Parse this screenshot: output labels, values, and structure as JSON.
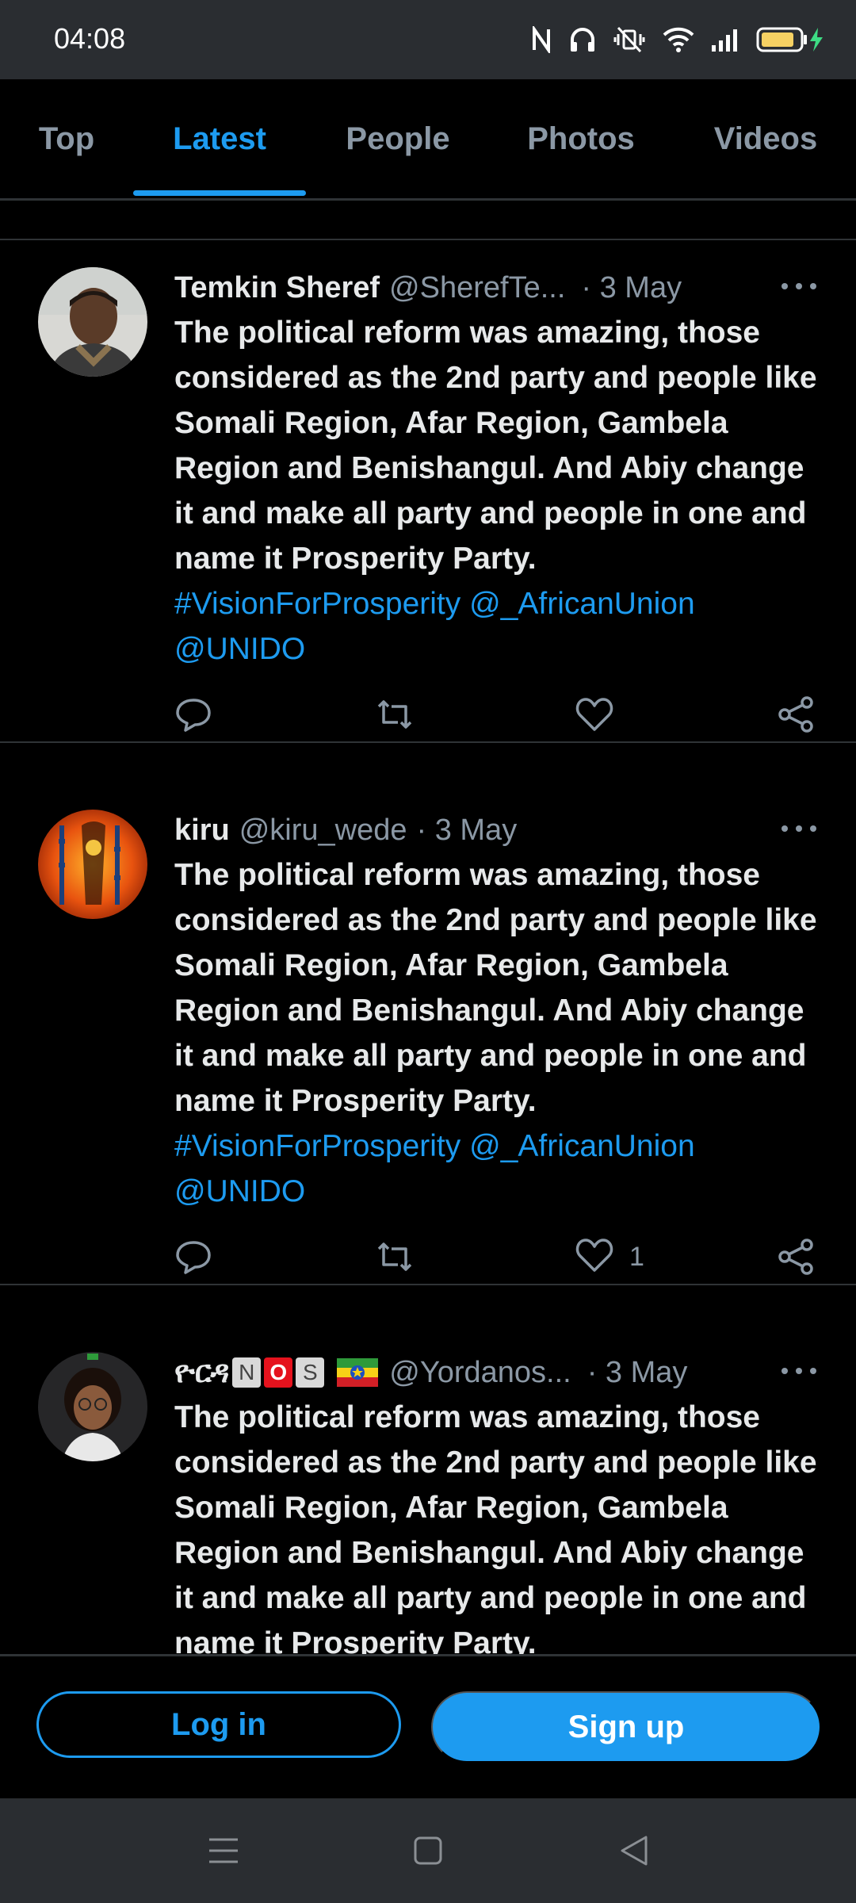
{
  "status_bar": {
    "time": "04:08",
    "icons": [
      "nfc-icon",
      "headphones-icon",
      "vibrate-off-icon",
      "wifi-icon",
      "signal-icon",
      "battery-charging-icon"
    ]
  },
  "tabs": [
    {
      "label": "Top",
      "active": false
    },
    {
      "label": "Latest",
      "active": true
    },
    {
      "label": "People",
      "active": false
    },
    {
      "label": "Photos",
      "active": false
    },
    {
      "label": "Videos",
      "active": false
    }
  ],
  "tweets": [
    {
      "name": "Temkin Sheref",
      "handle": "@SherefTe...",
      "date": "· 3 May",
      "text": "The political reform was amazing, those considered as the 2nd party and people like Somali Region, Afar Region, Gambela Region and Benishangul. And Abiy change it and make all party and people in one and name it Prosperity Party.",
      "link_line1": "#VisionForProsperity @_AfricanUnion",
      "link_line2": "@UNIDO",
      "likes": ""
    },
    {
      "name": "kiru",
      "handle": "@kiru_wede",
      "date": "· 3 May",
      "text": "The political reform was amazing, those considered as the 2nd party and people like Somali Region, Afar Region, Gambela Region and Benishangul. And Abiy change it and make all party and people in one and name it Prosperity Party.",
      "link_line1": "#VisionForProsperity @_AfricanUnion",
      "link_line2": "@UNIDO",
      "likes": "1"
    },
    {
      "name": "ዮርዳ",
      "name_badges": [
        "N",
        "O",
        "S"
      ],
      "handle": "@Yordanos...",
      "date": "· 3 May",
      "text": "The political reform was amazing, those considered as the 2nd party and people like Somali Region, Afar Region, Gambela Region and Benishangul. And Abiy change it and make all party and people in one and name it Prosperity Party."
    }
  ],
  "buttons": {
    "login": "Log in",
    "signup": "Sign up"
  },
  "colors": {
    "accent": "#1d9bf0",
    "muted": "#8b98a5",
    "text": "#e7e9ea",
    "divider": "#2f3336"
  }
}
